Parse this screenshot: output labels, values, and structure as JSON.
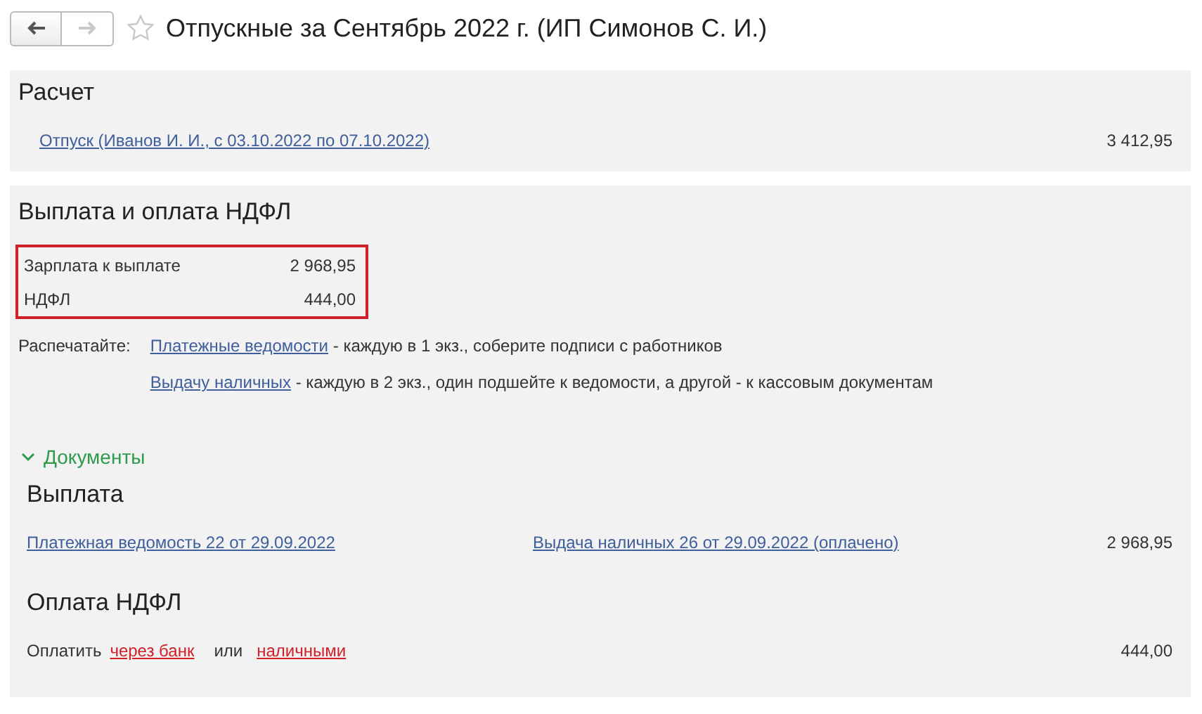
{
  "header": {
    "back": {
      "disabled": false
    },
    "forward": {
      "disabled": true
    },
    "favorite": false,
    "title": "Отпускные за Сентябрь 2022 г. (ИП Симонов С. И.)"
  },
  "calculation": {
    "title": "Расчет",
    "rows": [
      {
        "link": "Отпуск (Иванов И. И., с 03.10.2022 по 07.10.2022)",
        "amount": "3 412,95"
      }
    ]
  },
  "payment": {
    "title": "Выплата и оплата НДФЛ",
    "summary": {
      "highlighted": true,
      "rows": [
        {
          "label": "Зарплата к выплате",
          "value": "2 968,95"
        },
        {
          "label": "НДФЛ",
          "value": "444,00"
        }
      ]
    },
    "print": {
      "label": "Распечатайте:",
      "items": [
        {
          "link": "Платежные ведомости",
          "text": " - каждую в 1 экз., соберите подписи с работников"
        },
        {
          "link": "Выдачу наличных",
          "text": " - каждую в 2 экз., один подшейте к ведомости, а другой - к кассовым документам"
        }
      ]
    },
    "documents": {
      "label": "Документы",
      "expanded": true,
      "payout": {
        "title": "Выплата",
        "links": [
          "Платежная ведомость 22 от 29.09.2022",
          "Выдача наличных 26 от 29.09.2022 (оплачено)"
        ],
        "amount": "2 968,95"
      },
      "tax": {
        "title": "Оплата НДФЛ",
        "label": "Оплатить",
        "options": [
          "через банк",
          "наличными"
        ],
        "separator": "или",
        "amount": "444,00"
      }
    }
  }
}
